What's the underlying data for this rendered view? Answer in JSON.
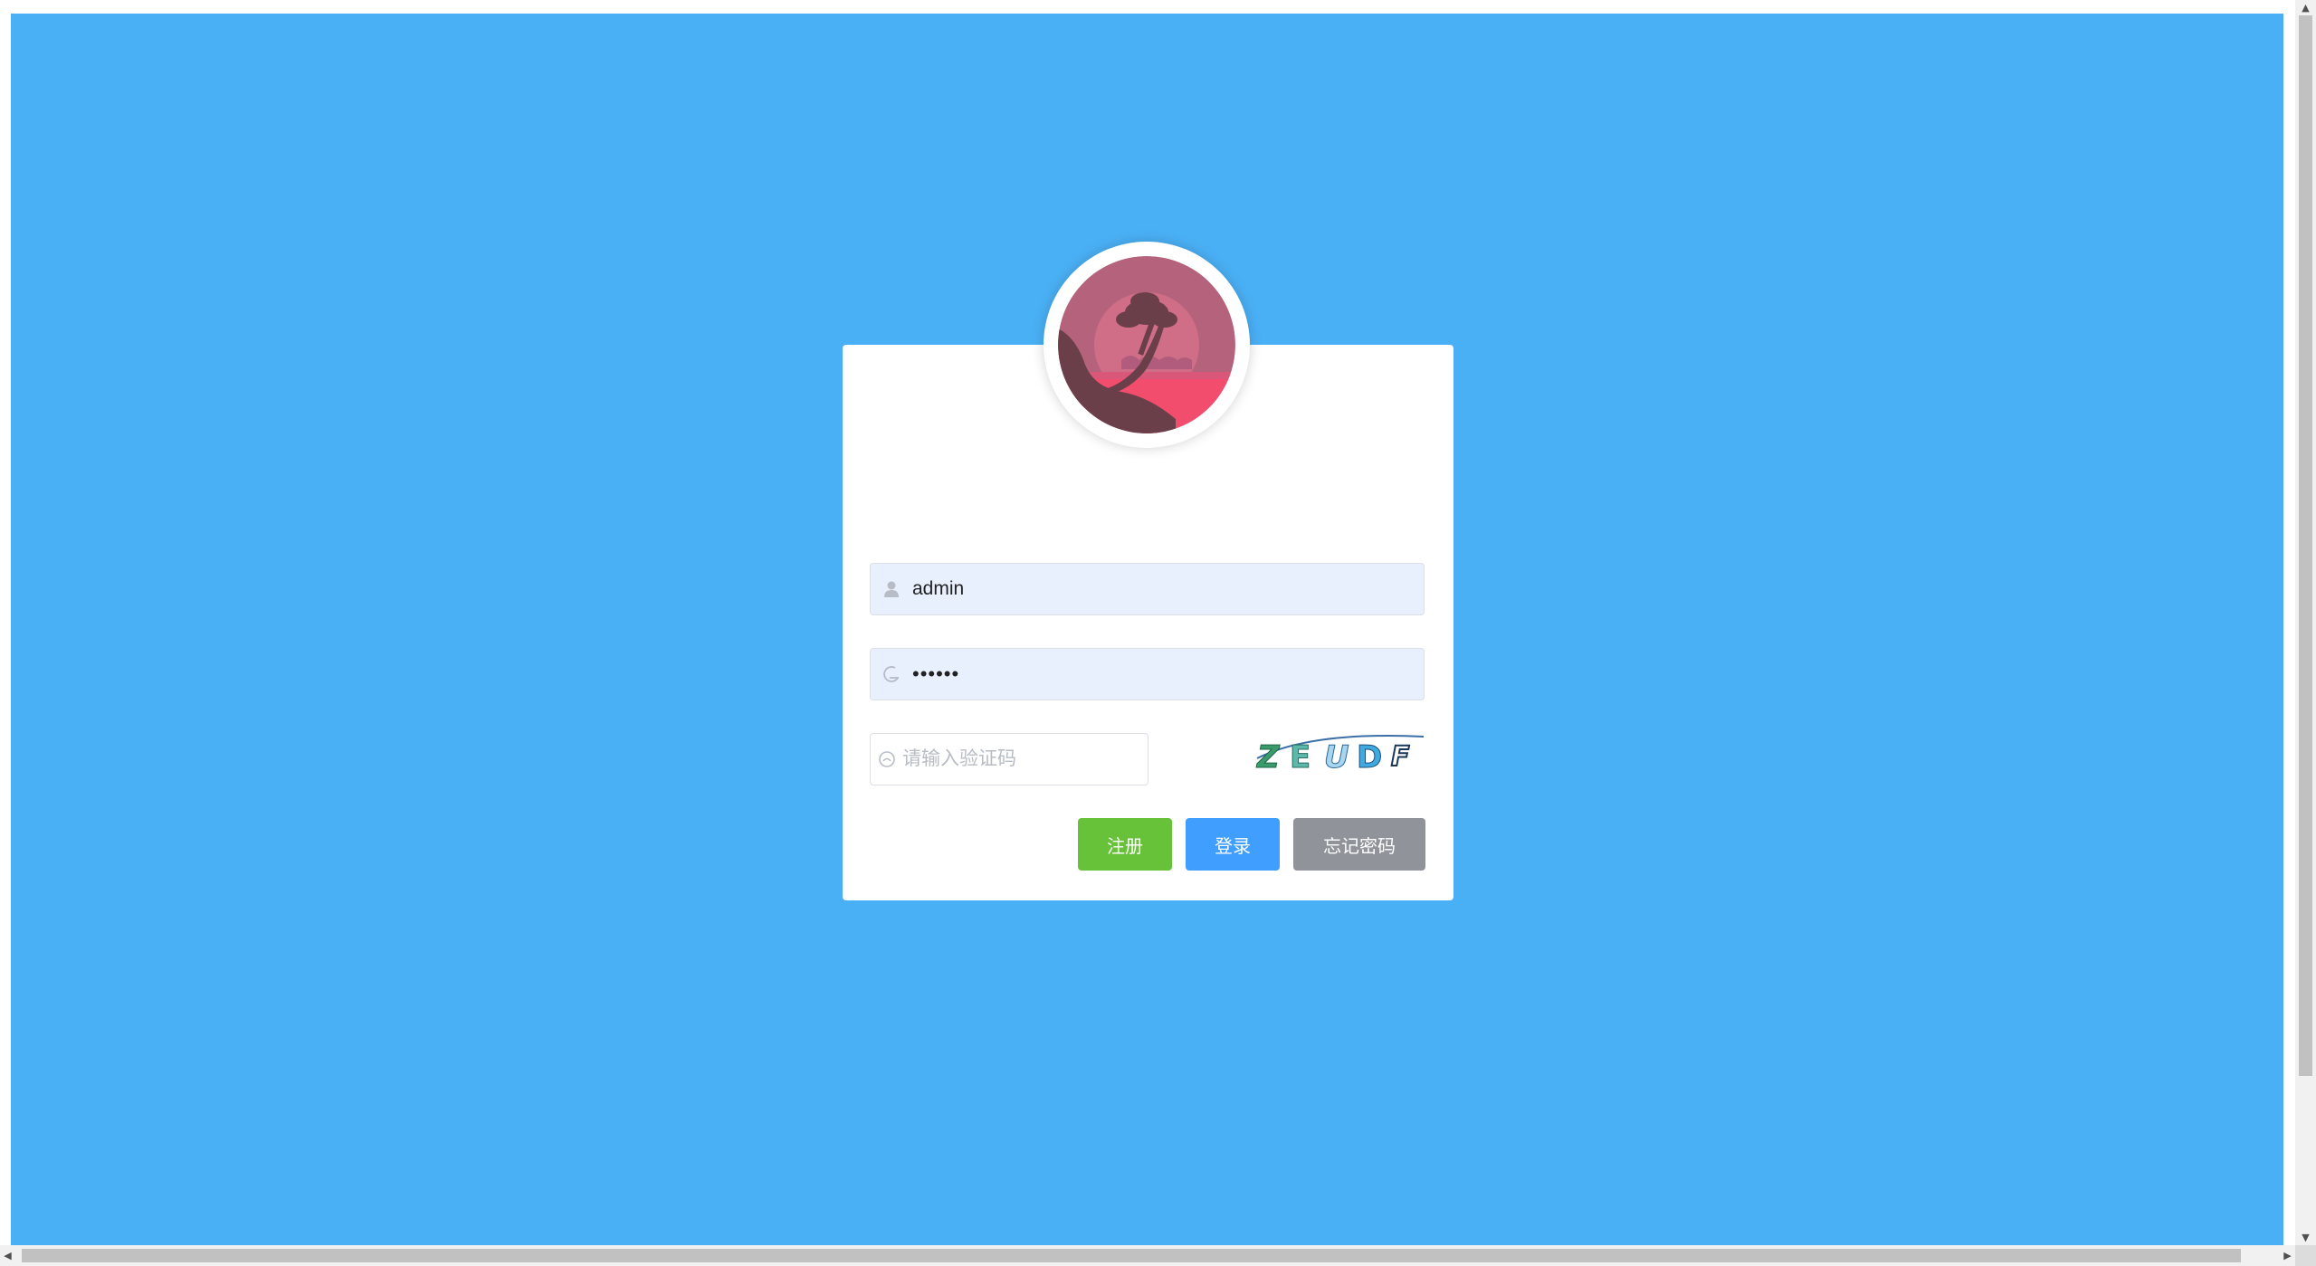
{
  "colors": {
    "page_background": "#4ab0f5",
    "card_background": "#ffffff",
    "register_button": "#67c23a",
    "login_button": "#409eff",
    "forgot_button": "#909399",
    "autofill_field": "#e8f0fe"
  },
  "avatar": {
    "icon": "sunset-tree-avatar"
  },
  "form": {
    "username": {
      "value": "admin",
      "icon": "user-icon"
    },
    "password": {
      "value": "••••••",
      "icon": "lock-icon"
    },
    "captcha": {
      "placeholder": "请输入验证码",
      "icon": "captcha-icon",
      "image_text": "ZEUDF"
    }
  },
  "buttons": {
    "register": "注册",
    "login": "登录",
    "forgot": "忘记密码"
  }
}
